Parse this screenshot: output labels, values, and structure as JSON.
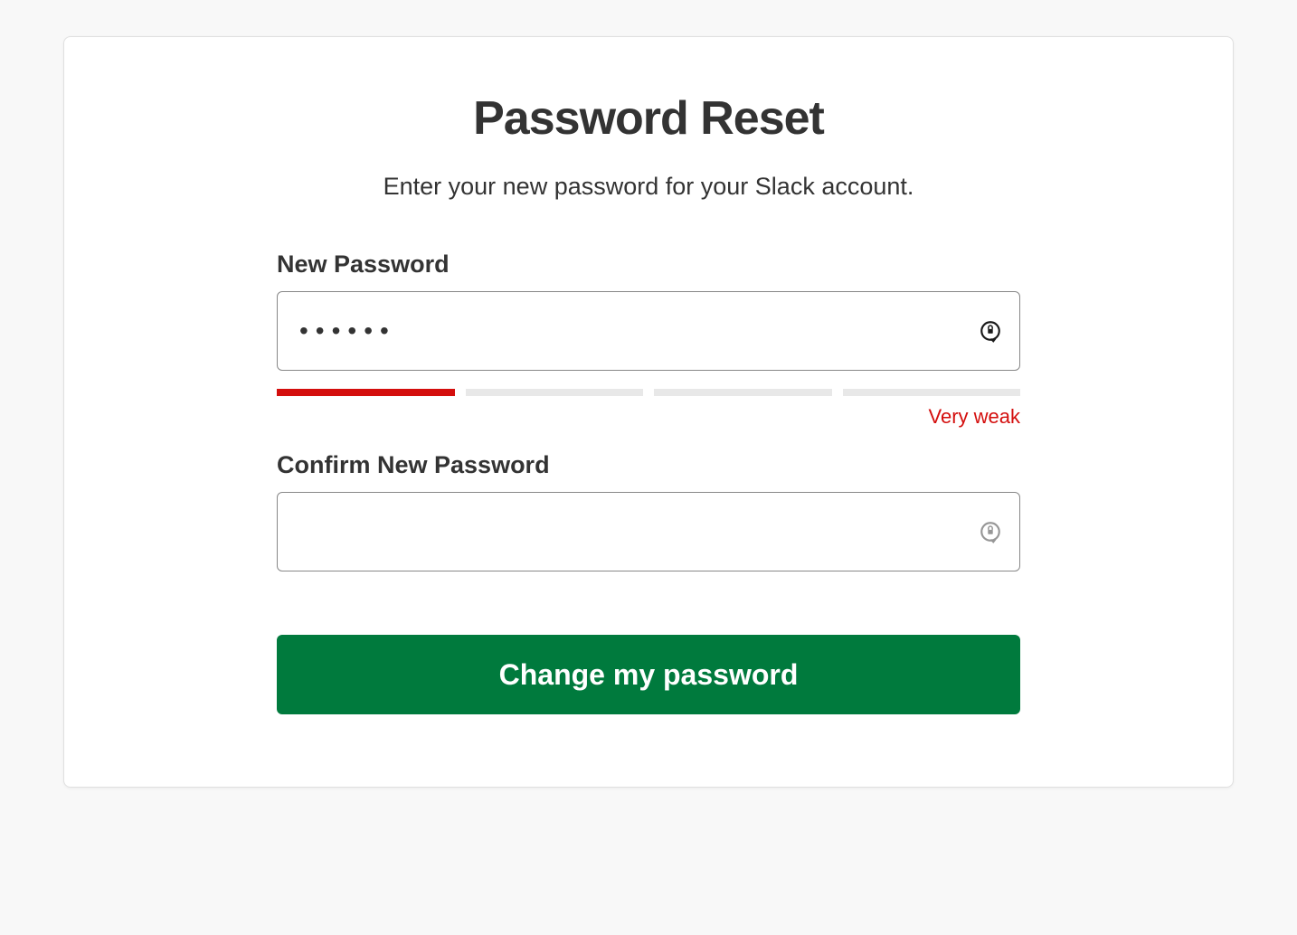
{
  "page": {
    "title": "Password Reset",
    "subtitle": "Enter your new password for your  Slack account."
  },
  "form": {
    "new_password": {
      "label": "New Password",
      "value": "••••••"
    },
    "strength": {
      "level": 1,
      "total_segments": 4,
      "label": "Very weak",
      "colors": {
        "active": "#d40e0d",
        "inactive": "#e8e8e8"
      }
    },
    "confirm_password": {
      "label": "Confirm New Password",
      "value": ""
    },
    "submit_label": "Change my password"
  }
}
